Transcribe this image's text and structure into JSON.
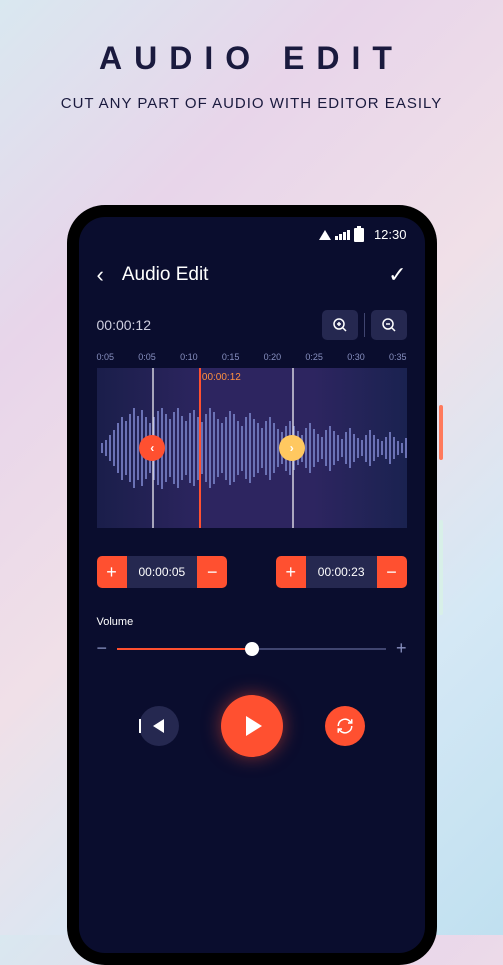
{
  "promo": {
    "title": "AUDIO EDIT",
    "subtitle": "CUT ANY PART OF AUDIO WITH EDITOR  EASILY"
  },
  "status": {
    "time": "12:30"
  },
  "header": {
    "title": "Audio Edit"
  },
  "current_time": "00:00:12",
  "ticks": [
    "0:05",
    "0:05",
    "0:10",
    "0:15",
    "0:20",
    "0:25",
    "0:30",
    "0:35"
  ],
  "playhead_label": "00:00:12",
  "range": {
    "start": "00:00:05",
    "end": "00:00:23"
  },
  "volume": {
    "label": "Volume",
    "percent": 50
  },
  "markers_pct": [
    18,
    63
  ],
  "colors": {
    "accent": "#ff5030",
    "bg": "#0a0d2e",
    "panel": "#252850"
  }
}
